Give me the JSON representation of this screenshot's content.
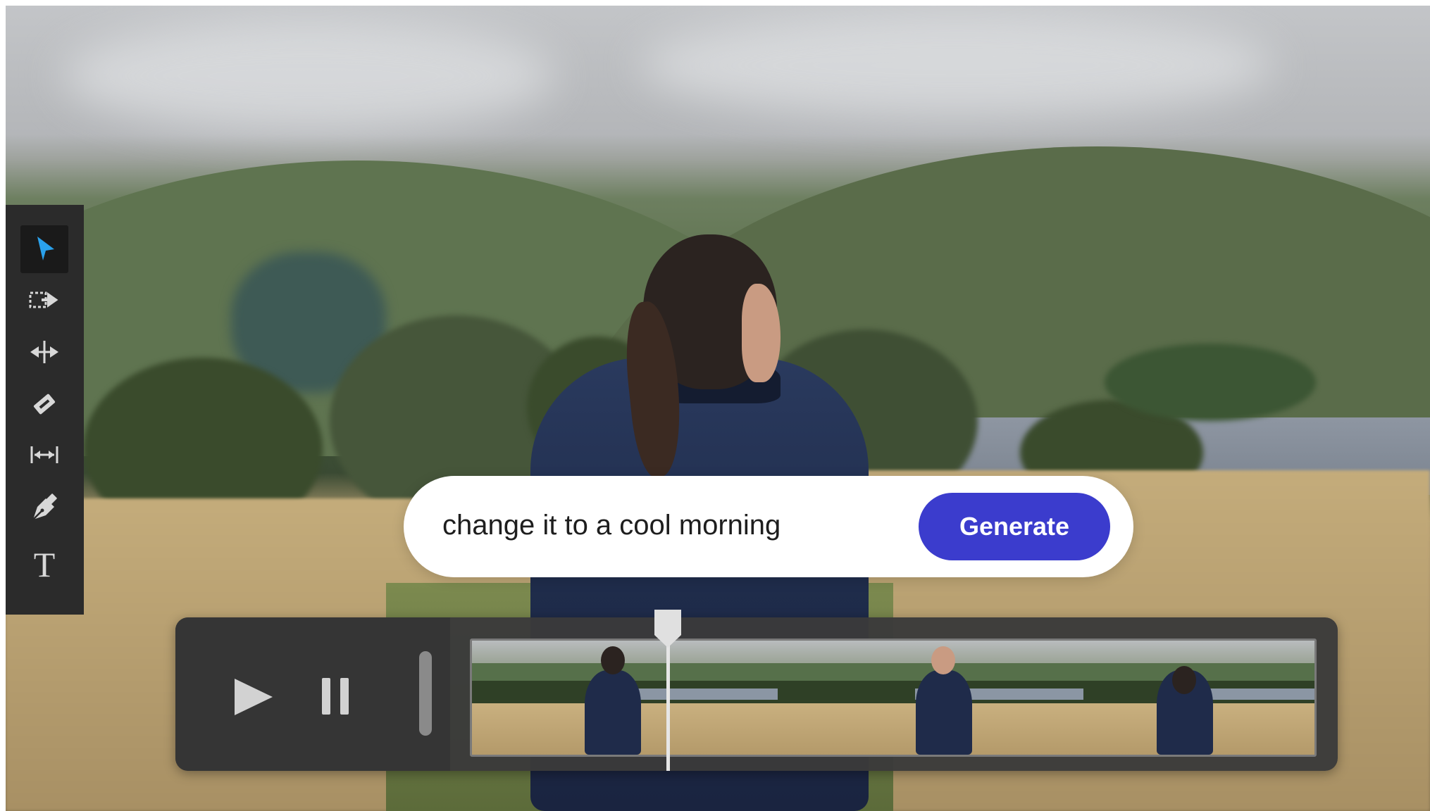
{
  "toolbar": {
    "tools": [
      {
        "name": "selection-tool",
        "icon": "selection-arrow-icon",
        "active": true
      },
      {
        "name": "track-select-forward-tool",
        "icon": "track-select-forward-icon",
        "active": false
      },
      {
        "name": "ripple-edit-tool",
        "icon": "ripple-edit-icon",
        "active": false
      },
      {
        "name": "razor-tool",
        "icon": "razor-icon",
        "active": false
      },
      {
        "name": "slip-tool",
        "icon": "slip-icon",
        "active": false
      },
      {
        "name": "pen-tool",
        "icon": "pen-icon",
        "active": false
      },
      {
        "name": "type-tool",
        "icon": "type-icon",
        "active": false
      }
    ],
    "type_glyph": "T"
  },
  "prompt": {
    "value": "change it to a cool morning",
    "button_label": "Generate"
  },
  "timeline": {
    "play_icon": "play-icon",
    "pause_icon": "pause-icon",
    "thumbnails": 3
  },
  "colors": {
    "accent": "#3b3ccd",
    "selection_arrow": "#2aa1ec",
    "toolbar_bg": "#2b2b2b"
  }
}
